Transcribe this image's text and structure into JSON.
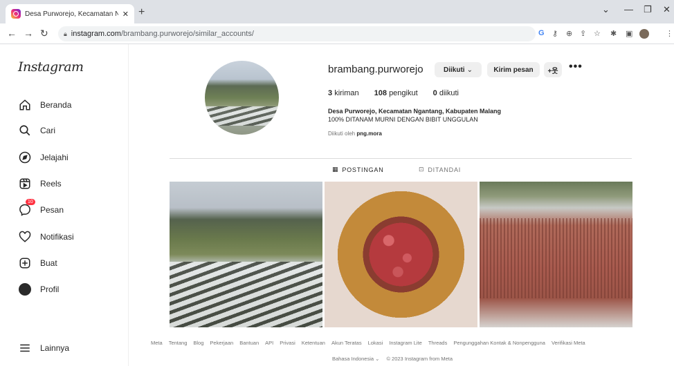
{
  "browser": {
    "tab_title": "Desa Purworejo, Kecamatan Nga",
    "tab_close": "✕",
    "new_tab": "+",
    "url_domain": "instagram.com",
    "url_path": "/brambang.purworejo/similar_accounts/",
    "win_minimize": "—",
    "win_maximize": "❐",
    "win_close": "✕",
    "win_dropdown": "⌄"
  },
  "sidebar": {
    "logo": "Instagram",
    "items": [
      {
        "label": "Beranda",
        "icon": "home-icon"
      },
      {
        "label": "Cari",
        "icon": "search-icon"
      },
      {
        "label": "Jelajahi",
        "icon": "compass-icon"
      },
      {
        "label": "Reels",
        "icon": "reels-icon"
      },
      {
        "label": "Pesan",
        "icon": "messenger-icon",
        "badge": "10"
      },
      {
        "label": "Notifikasi",
        "icon": "heart-icon"
      },
      {
        "label": "Buat",
        "icon": "plus-square-icon"
      },
      {
        "label": "Profil",
        "icon": "avatar-icon"
      }
    ],
    "more": "Lainnya"
  },
  "profile": {
    "username": "brambang.purworejo",
    "following_button": "Diikuti",
    "message_button": "Kirim pesan",
    "posts_count": "3",
    "posts_label": "kiriman",
    "followers_count": "108",
    "followers_label": "pengikut",
    "following_count": "0",
    "following_label": "diikuti",
    "bio_name": "Desa Purworejo, Kecamatan Ngantang, Kabupaten Malang",
    "bio_text": "100% DITANAM MURNI DENGAN BIBIT UNGGULAN",
    "followed_by_prefix": "Diikuti oleh",
    "followed_by_user": "png.mora"
  },
  "tabs": {
    "posts": "POSTINGAN",
    "tagged": "DITANDAI"
  },
  "footer": {
    "links": [
      "Meta",
      "Tentang",
      "Blog",
      "Pekerjaan",
      "Bantuan",
      "API",
      "Privasi",
      "Ketentuan",
      "Akun Teratas",
      "Lokasi",
      "Instagram Lite",
      "Threads",
      "Pengunggahan Kontak & Nonpengguna",
      "Verifikasi Meta"
    ],
    "language": "Bahasa Indonesia",
    "copyright": "© 2023 Instagram from Meta"
  }
}
